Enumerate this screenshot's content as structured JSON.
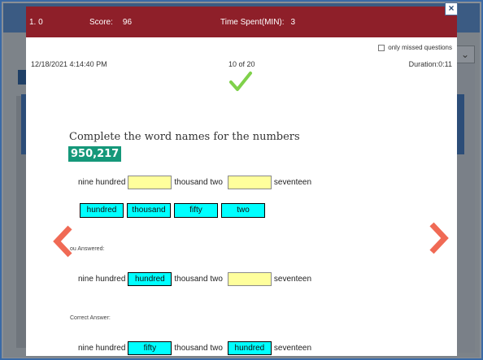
{
  "header": {
    "level": "1. 0",
    "score_label": "Score:",
    "score_value": "96",
    "time_label": "Time Spent(MIN):",
    "time_value": "3",
    "close_glyph": "×"
  },
  "options": {
    "missed_label": "only missed questions"
  },
  "meta": {
    "date": "12/18/2021 4:14:40 PM",
    "progress": "10 of 20",
    "duration": "Duration:0:11"
  },
  "question": {
    "prompt": "Complete the word names for the numbers",
    "number": "950,217",
    "before": "nine hundred",
    "middle": "thousand two",
    "after": "seventeen",
    "choices": [
      "hundred",
      "thousand",
      "fifty",
      "two"
    ]
  },
  "your_answer": {
    "label": "ou Answered:",
    "before": "nine hundred",
    "blank1": "hundred",
    "middle": "thousand two",
    "blank2": "",
    "after": "seventeen"
  },
  "correct_answer": {
    "label": "Correct Answer:",
    "before": "nine hundred",
    "blank1": "fifty",
    "middle": "thousand two",
    "blank2": "hundred",
    "after": "seventeen"
  },
  "icons": {
    "result": "check-icon",
    "prev": "chevron-left-icon",
    "next": "chevron-right-icon",
    "dropdown": "chevron-down-icon"
  },
  "colors": {
    "header": "#8e1f29",
    "accent_badge": "#15987a",
    "answer_tile": "#00ffff",
    "blank": "#ffff9c",
    "nav_arrow": "#f06a55",
    "check": "#7fd14a"
  }
}
